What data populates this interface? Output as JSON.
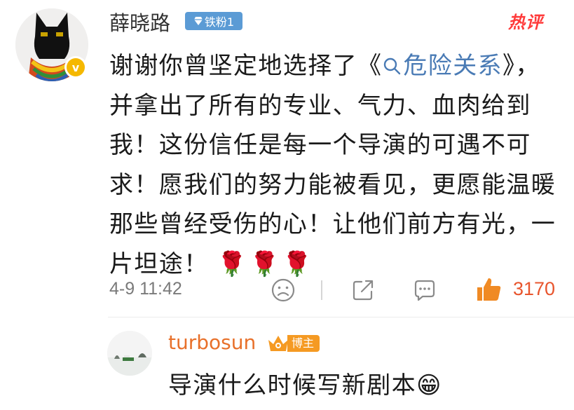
{
  "comment": {
    "username": "薛晓路",
    "fan_badge": "铁粉1",
    "hot_tag": "热评",
    "text_before": "谢谢你曾坚定地选择了《",
    "link_text": "危险关系",
    "text_after": "》，并拿出了所有的专业、气力、血肉给到我！这份信任是每一个导演的可遇不可求！愿我们的努力能被看见，更愿能温暖那些曾经受伤的心！让他们前方有光，一片坦途！",
    "roses": "🌹🌹🌹",
    "time": "4-9 11:42",
    "likes": "3170"
  },
  "reply": {
    "username": "turbosun",
    "badge": "博主",
    "text": "导演什么时候写新剧本",
    "emoji": "😁"
  },
  "icons": {
    "verified": "verified-v-icon",
    "fan_badge": "diamond-icon",
    "search_link": "search-icon",
    "dislike": "sad-face-icon",
    "share": "share-icon",
    "comment": "comment-icon",
    "like": "thumbs-up-icon",
    "blogger": "crown-icon"
  },
  "colors": {
    "link": "#4a7bb5",
    "likes": "#e8552d",
    "hot_tag": "#ff3b3b",
    "fan_badge_bg": "#5b9bd5",
    "reply_name": "#e8702a",
    "blogger_badge_bg": "#f59a23"
  }
}
